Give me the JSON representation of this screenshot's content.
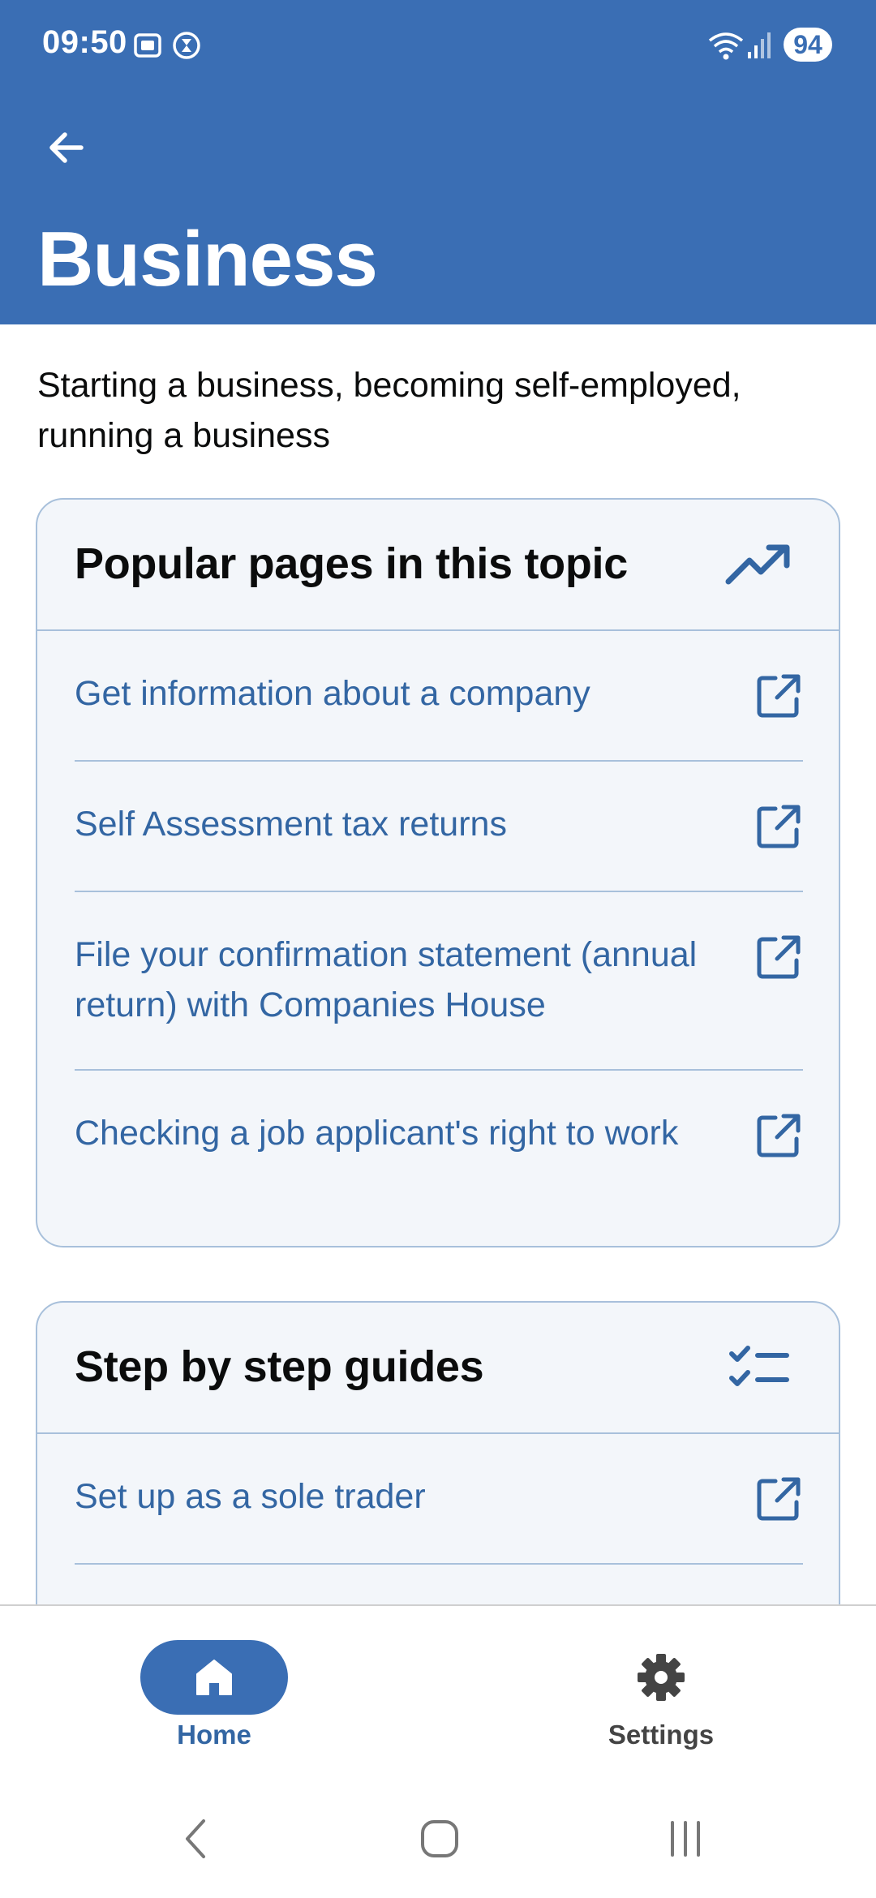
{
  "status_bar": {
    "time": "09:50",
    "battery": "94",
    "icons": [
      "screenshot-icon",
      "timer-icon",
      "wifi-icon",
      "signal-icon"
    ]
  },
  "header": {
    "title": "Business",
    "back_icon": "arrow-left-icon",
    "background_color": "#3a6eb4"
  },
  "description": "Starting a business, becoming self-employed, running a business",
  "popular": {
    "title": "Popular pages in this topic",
    "icon": "trending-up-icon",
    "items": [
      {
        "label": "Get information about a company"
      },
      {
        "label": "Self Assessment tax returns"
      },
      {
        "label": "File your confirmation statement (annual return) with Companies House"
      },
      {
        "label": "Checking a job applicant's right to work"
      }
    ]
  },
  "guides": {
    "title": "Step by step guides",
    "icon": "checklist-icon",
    "items": [
      {
        "label": "Set up as a sole trader"
      }
    ]
  },
  "bottom_nav": {
    "home_label": "Home",
    "settings_label": "Settings",
    "active": "Home",
    "accent_color": "#3a6eb4"
  },
  "colors": {
    "link": "#3366a3",
    "card_border": "#a8c0db",
    "card_bg": "#f3f6fa"
  }
}
